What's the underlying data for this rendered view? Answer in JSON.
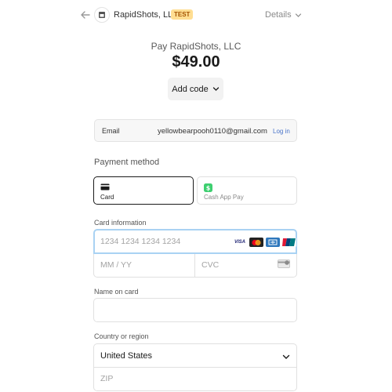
{
  "header": {
    "merchant_name": "RapidShots, LLC",
    "test_badge": "TEST",
    "details_label": "Details"
  },
  "summary": {
    "pay_title": "Pay RapidShots, LLC",
    "amount": "$49.00",
    "add_code_label": "Add code"
  },
  "email": {
    "label": "Email",
    "value": "yellowbearpooh0110@gmail.com",
    "login_label": "Log in"
  },
  "payment_method": {
    "heading": "Payment method",
    "tabs": [
      {
        "label": "Card",
        "icon": "credit-card-icon",
        "selected": true
      },
      {
        "label": "Cash App Pay",
        "icon": "cash-app-icon",
        "selected": false
      }
    ]
  },
  "card_info": {
    "heading": "Card information",
    "number_placeholder": "1234 1234 1234 1234",
    "expiry_placeholder": "MM / YY",
    "cvc_placeholder": "CVC",
    "brands": [
      "VISA",
      "mastercard",
      "amex",
      "unionpay"
    ]
  },
  "name_on_card": {
    "label": "Name on card",
    "value": ""
  },
  "country": {
    "label": "Country or region",
    "value": "United States",
    "zip_placeholder": "ZIP"
  },
  "colors": {
    "accent_focus": "#a9d2f3",
    "test_badge_bg": "#ffde92",
    "link": "#4a74c9",
    "cash_app_green": "#3ecf70"
  }
}
